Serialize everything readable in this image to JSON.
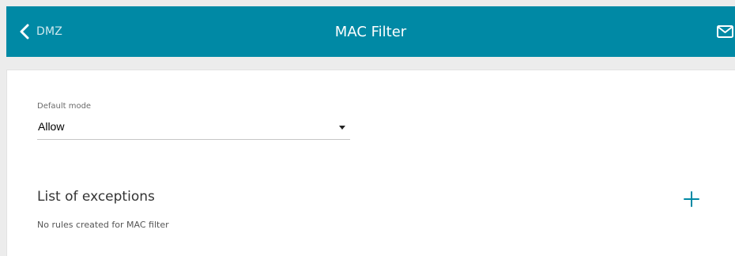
{
  "header": {
    "back_label": "DMZ",
    "title": "MAC Filter",
    "icons": {
      "back": "chevron-left-icon",
      "notifications": "mail-icon"
    },
    "colors": {
      "background": "#0089a5",
      "text": "#ffffff"
    }
  },
  "settings": {
    "default_mode": {
      "label": "Default mode",
      "value": "Allow"
    }
  },
  "exceptions": {
    "title": "List of exceptions",
    "add_icon": "plus-icon",
    "empty_message": "No rules created for MAC filter"
  },
  "colors": {
    "accent": "#0089a5"
  }
}
